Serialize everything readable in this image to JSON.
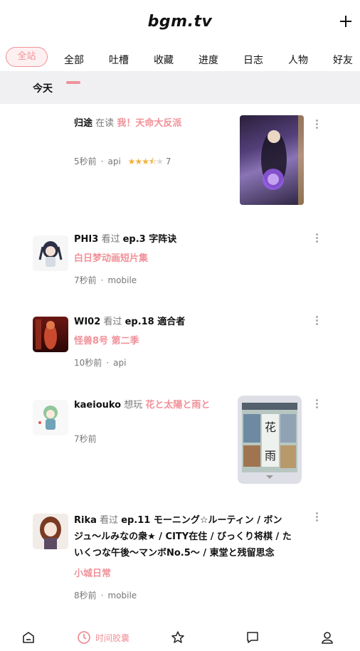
{
  "header": {
    "logo": "bgm.tv",
    "add_icon": "plus-icon"
  },
  "tabs": {
    "site": "全站",
    "items": [
      "全部",
      "吐槽",
      "收藏",
      "进度",
      "日志",
      "人物",
      "好友"
    ]
  },
  "subtabs": {
    "today": "今天"
  },
  "feed": [
    {
      "user": "归途",
      "verb": "在读",
      "subject": "我！天命大反派",
      "time": "5秒前",
      "source": "api",
      "rating": "7",
      "stars_filled": 3.5
    },
    {
      "user": "PHI3",
      "verb": "看过",
      "ep": "ep.3 字阵诀",
      "subject": "白日梦动画短片集",
      "time": "7秒前",
      "source": "mobile"
    },
    {
      "user": "WI02",
      "verb": "看过",
      "ep": "ep.18 適合者",
      "subject": "怪兽8号 第二季",
      "time": "10秒前",
      "source": "api"
    },
    {
      "user": "kaeiouko",
      "verb": "想玩",
      "subject": "花と太陽と雨と",
      "time": "7秒前"
    },
    {
      "user": "Rika",
      "verb": "看过",
      "ep_lines": [
        "ep.11 モーニング☆ルーティン / ボン",
        "ジュ～ルみなの衆★ / CITY在住 / びっくり将棋 / た",
        "いくつな午後～マンボNo.5～ / 東堂と残留思念"
      ],
      "subject": "小城日常",
      "time": "8秒前",
      "source": "mobile"
    }
  ],
  "bottom_nav": {
    "active_label": "时间胶囊"
  },
  "colors": {
    "accent": "#f09199",
    "star": "#f2b13b"
  }
}
